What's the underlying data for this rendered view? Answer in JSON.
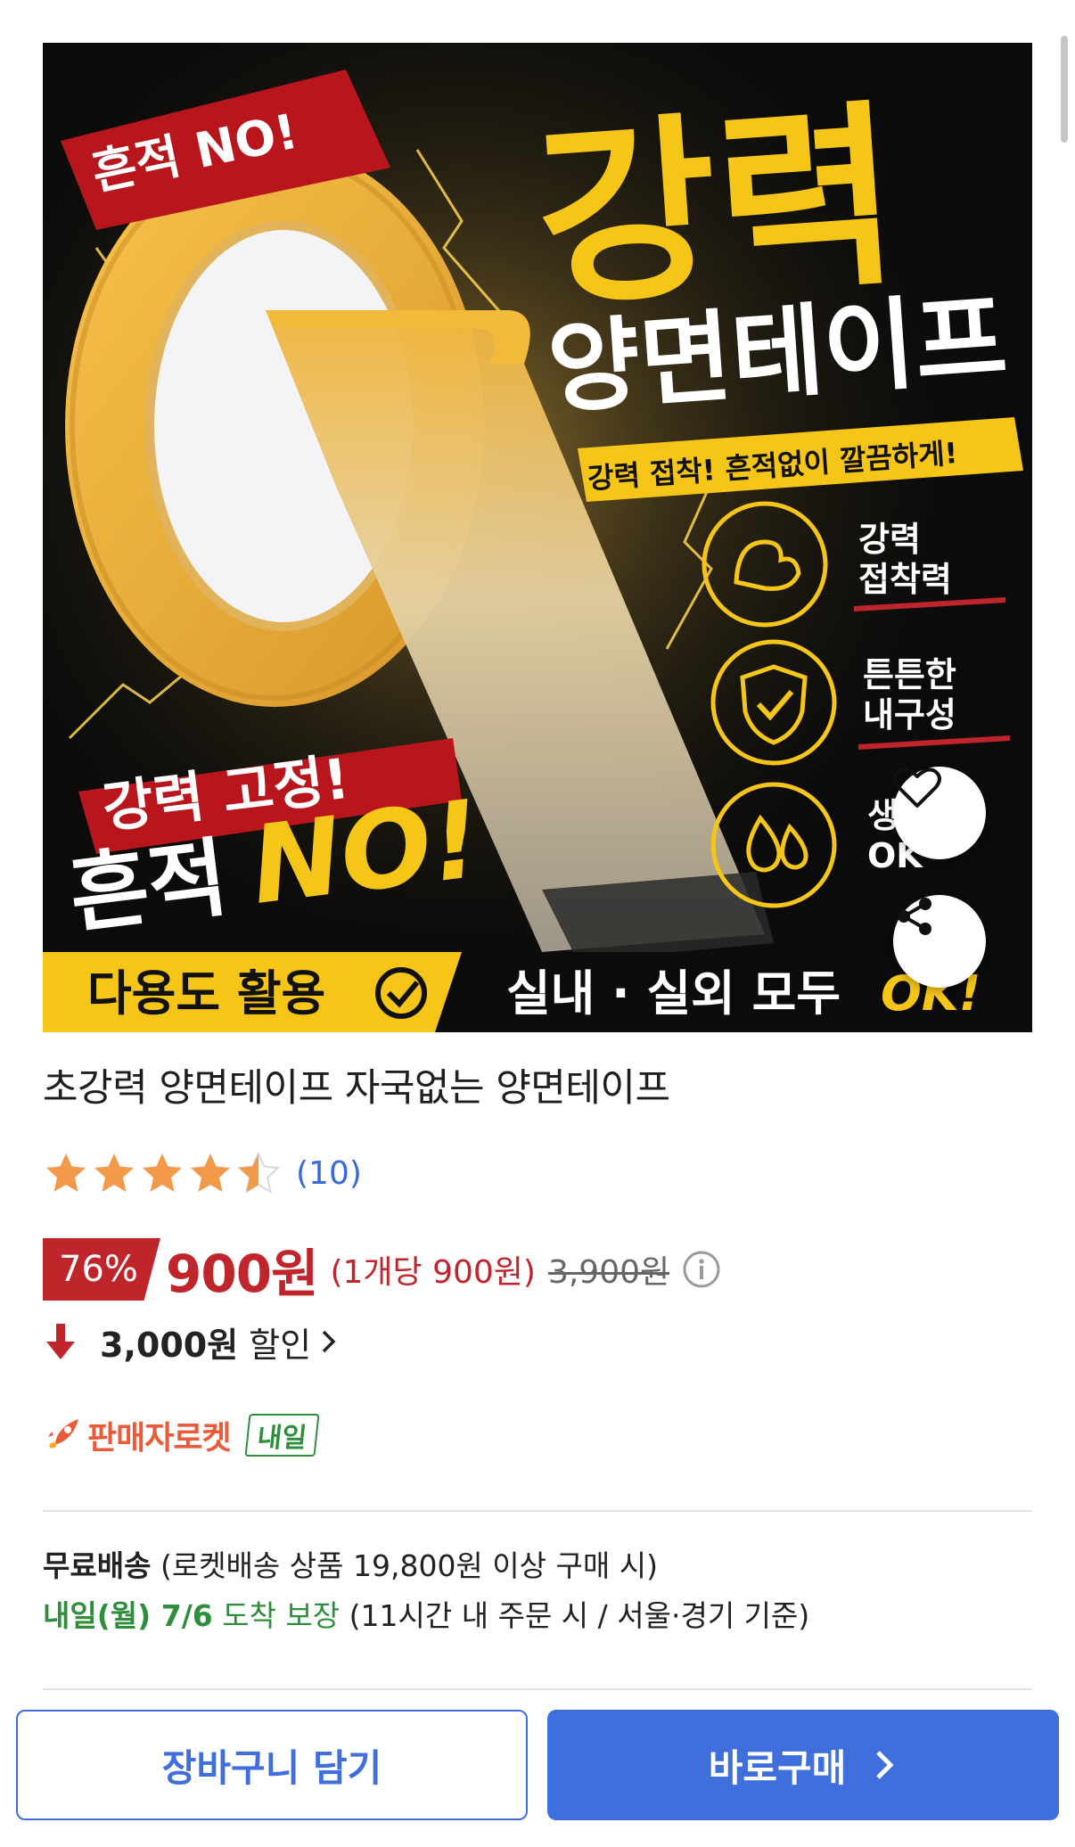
{
  "product": {
    "title": "초강력 양면테이프 자국없는 양면테이프",
    "image": {
      "badge_top": "흔적 NO!",
      "headline_main": "강력",
      "headline_sub": "양면테이프",
      "tagline": "강력 접착! 흔적없이 깔끔하게!",
      "features": [
        {
          "icon": "muscle-icon",
          "line1": "강력",
          "line2": "접착력"
        },
        {
          "icon": "shield-check-icon",
          "line1": "튼튼한",
          "line2": "내구성"
        },
        {
          "icon": "water-drops-icon",
          "line1": "생",
          "line2": "OK"
        }
      ],
      "slogan_1": "강력 고정!",
      "slogan_2_a": "흔적",
      "slogan_2_b": "NO!",
      "bottom_left": "다용도 활용",
      "bottom_right_a": "실내 · 실외 모두",
      "bottom_right_b": "OK!"
    },
    "actions": {
      "wishlist_icon": "heart-icon",
      "share_icon": "share-icon"
    }
  },
  "rating": {
    "stars": 4.5,
    "max": 5,
    "count_label": "(10)"
  },
  "price": {
    "discount": "76%",
    "sale": "900원",
    "unit": "(1개당 900원)",
    "original": "3,900원"
  },
  "coupon": {
    "amount": "3,000원",
    "label": "할인"
  },
  "delivery": {
    "rocket_label": "판매자로켓",
    "tomorrow_badge": "내일",
    "free_shipping": "무료배송",
    "free_shipping_condition": "(로켓배송 상품 19,800원 이상 구매 시)",
    "arrival_date": "내일(월) 7/6",
    "arrival_guarantee": "도착 보장",
    "arrival_condition": "(11시간 내 주문 시 / 서울·경기 기준)"
  },
  "buttons": {
    "cart": "장바구니 담기",
    "buy": "바로구매"
  },
  "colors": {
    "accent_blue": "#3f6fdc",
    "sale_red": "#c0252b",
    "green": "#2f8e3c",
    "star": "#f39a4a",
    "image_yellow": "#f5c518"
  }
}
